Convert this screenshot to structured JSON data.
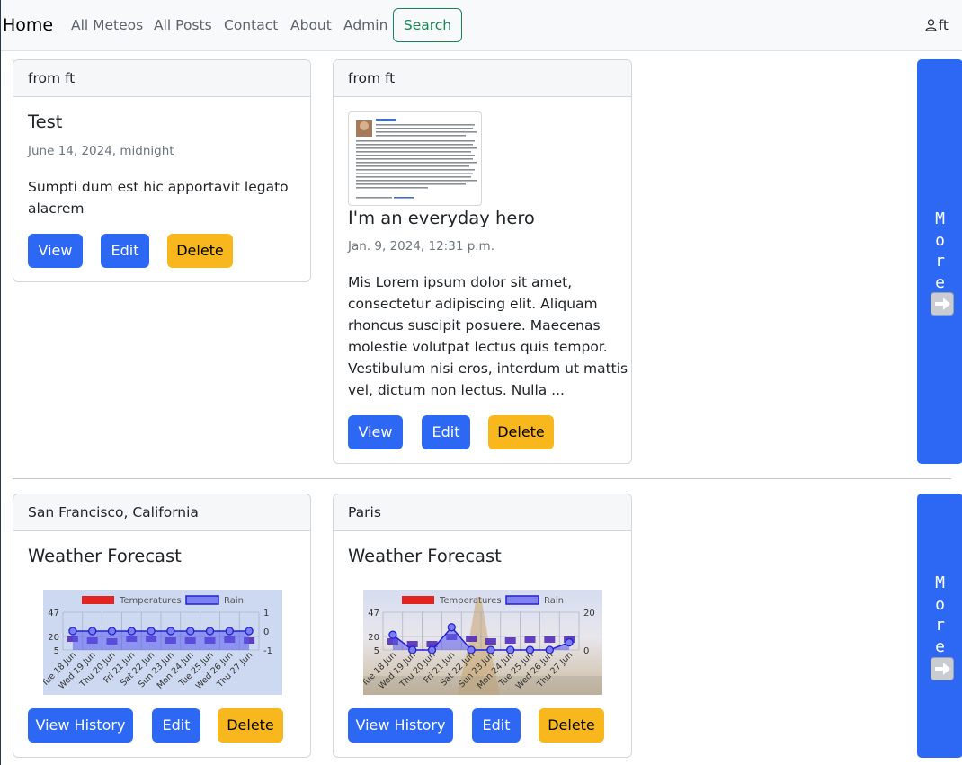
{
  "nav": {
    "brand": "Home",
    "links": [
      "All Meteos",
      "All Posts",
      "Contact",
      "About",
      "Admin"
    ],
    "search_label": "Search",
    "user": "ft"
  },
  "posts": [
    {
      "header": "from ft",
      "title": "Test",
      "date": "June 14, 2024, midnight",
      "text_lines": [
        "Sumpti dum est hic apportavit legato",
        "alacrem"
      ],
      "buttons": [
        "View",
        "Edit",
        "Delete"
      ]
    },
    {
      "header": "from ft",
      "title": "I'm an everyday hero",
      "date": "Jan. 9, 2024, 12:31 p.m.",
      "text_lines": [
        "Mis Lorem ipsum dolor sit amet,",
        "consectetur adipiscing elit. Aliquam",
        "rhoncus suscipit posuere. Maecenas",
        "molestie volutpat lectus quis tempor.",
        "Vestibulum nisi eros, interdum ut mattis",
        "vel, dictum non lectus. Nulla ..."
      ],
      "buttons": [
        "View",
        "Edit",
        "Delete"
      ],
      "thumbnail_icon": "post-screenshot-image"
    }
  ],
  "meteos": [
    {
      "header": "San Francisco, California",
      "title": "Weather Forecast",
      "buttons": [
        "View History",
        "Edit",
        "Delete"
      ]
    },
    {
      "header": "Paris",
      "title": "Weather Forecast",
      "buttons": [
        "View History",
        "Edit",
        "Delete"
      ]
    }
  ],
  "more": {
    "letters": [
      "M",
      "o",
      "r",
      "e"
    ],
    "icon": "arrow-right-icon"
  },
  "colors": {
    "primary": "#2d68f5",
    "warning": "#f8b81d",
    "success": "#198754",
    "temperature": "#e32320",
    "rain": "#5a5af0"
  },
  "chart_data": [
    {
      "type": "line",
      "title": "",
      "legend": [
        "Temperatures",
        "Rain"
      ],
      "legend_placement": "top",
      "categories": [
        "Tue 18 Jun",
        "Wed 19 Jun",
        "Thu 20 Jun",
        "Fri 21 Jun",
        "Sat 22 Jun",
        "Sun 23 Jun",
        "Mon 24 Jun",
        "Tue 25 Jun",
        "Wed 26 Jun",
        "Thu 27 Jun"
      ],
      "y_ticks_left": [
        5,
        20,
        47
      ],
      "y_ticks_right": [
        -1,
        0,
        1
      ],
      "ylim_left": [
        5,
        47
      ],
      "ylim_right": [
        -1,
        1
      ],
      "grid": true,
      "series": [
        {
          "name": "Temperatures",
          "values": [
            20,
            18,
            17,
            20,
            20,
            18,
            18,
            18,
            19,
            18
          ]
        },
        {
          "name": "Rain",
          "values": [
            0,
            0,
            0,
            0,
            0,
            0,
            0,
            0,
            0,
            0
          ]
        }
      ]
    },
    {
      "type": "line",
      "title": "",
      "legend": [
        "Temperatures",
        "Rain"
      ],
      "legend_placement": "top",
      "categories": [
        "Tue 18 Jun",
        "Wed 19 Jun",
        "Thu 20 Jun",
        "Fri 21 Jun",
        "Sat 22 Jun",
        "Sun 23 Jun",
        "Mon 24 Jun",
        "Tue 25 Jun",
        "Wed 26 Jun",
        "Thu 27 Jun"
      ],
      "y_ticks_left": [
        5,
        20,
        47
      ],
      "y_ticks_right": [
        0,
        20
      ],
      "ylim_left": [
        5,
        47
      ],
      "ylim_right": [
        0,
        20
      ],
      "grid": true,
      "series": [
        {
          "name": "Temperatures",
          "values": [
            17,
            14,
            14,
            22,
            20,
            17,
            18,
            19,
            19,
            19
          ]
        },
        {
          "name": "Rain",
          "values": [
            8,
            0,
            0,
            12,
            0,
            0,
            0,
            0,
            0,
            4
          ]
        }
      ]
    }
  ]
}
